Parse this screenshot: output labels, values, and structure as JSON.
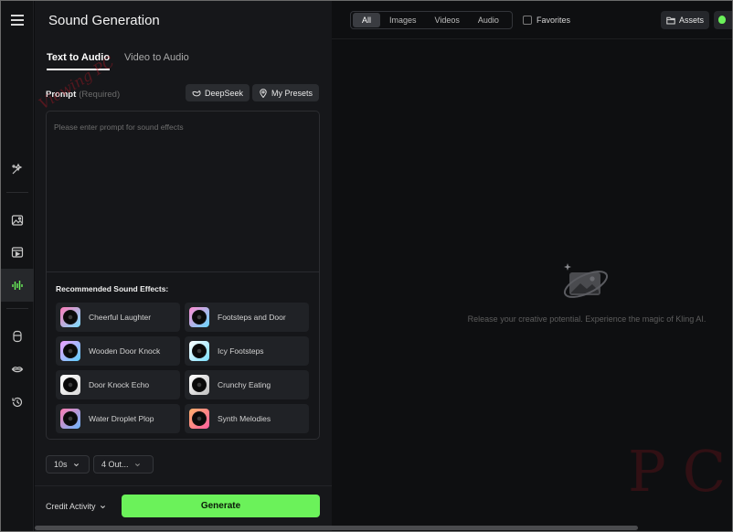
{
  "app": {
    "title": "Sound Generation"
  },
  "tabs": [
    {
      "label": "Text to Audio",
      "active": true
    },
    {
      "label": "Video to Audio",
      "active": false
    }
  ],
  "prompt": {
    "label": "Prompt",
    "required_note": "(Required)",
    "placeholder": "Please enter prompt for sound effects",
    "deepseek_label": "DeepSeek",
    "presets_label": "My Presets"
  },
  "recommended": {
    "title": "Recommended Sound Effects:",
    "items": [
      "Cheerful Laughter",
      "Footsteps and Door",
      "Wooden Door Knock",
      "Icy Footsteps",
      "Door Knock Echo",
      "Crunchy Eating",
      "Water Droplet Plop",
      "Synth Melodies"
    ]
  },
  "options": {
    "duration": "10s",
    "outputs": "4 Out..."
  },
  "footer": {
    "credit_label": "Credit Activity",
    "generate_label": "Generate"
  },
  "filters": [
    {
      "label": "All",
      "active": true
    },
    {
      "label": "Images",
      "active": false
    },
    {
      "label": "Videos",
      "active": false
    },
    {
      "label": "Audio",
      "active": false
    }
  ],
  "favorites_label": "Favorites",
  "assets_label": "Assets",
  "empty_state": "Release your creative potential. Experience the magic of Kling AI.",
  "watermark": {
    "site": "Viewing PC",
    "mark": "PC"
  },
  "colors": {
    "accent": "#6bf25a",
    "background": "#0e0f11",
    "panel": "#16171a"
  },
  "rail_icons": [
    "menu-icon",
    "magic-wand-icon",
    "image-icon",
    "video-icon",
    "sound-wave-icon",
    "avatar-icon",
    "lips-icon",
    "history-icon"
  ]
}
